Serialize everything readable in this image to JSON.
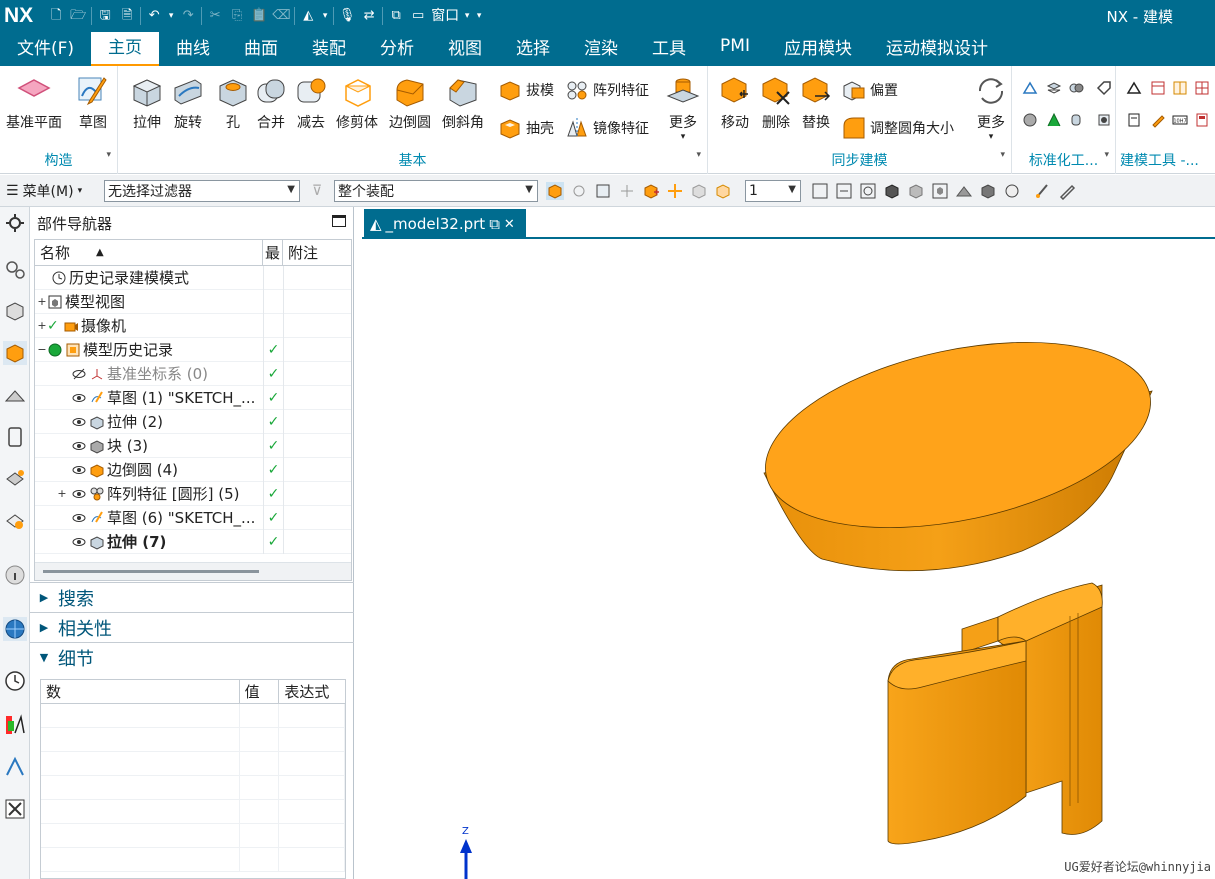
{
  "app": {
    "logo": "NX",
    "title": "NX - 建模",
    "window_menu": "窗口"
  },
  "menu_tabs": [
    "文件(F)",
    "主页",
    "曲线",
    "曲面",
    "装配",
    "分析",
    "视图",
    "选择",
    "渲染",
    "工具",
    "PMI",
    "应用模块",
    "运动模拟设计"
  ],
  "active_tab": "主页",
  "ribbon": {
    "construct": {
      "label": "构造",
      "buttons": [
        "基准平面",
        "草图"
      ]
    },
    "basic": {
      "label": "基本",
      "buttons": [
        "拉伸",
        "旋转",
        "孔",
        "合并",
        "减去",
        "修剪体",
        "边倒圆",
        "倒斜角"
      ],
      "small": [
        "拔模",
        "阵列特征",
        "抽壳",
        "镜像特征"
      ],
      "more": "更多"
    },
    "sync": {
      "label": "同步建模",
      "buttons": [
        "移动",
        "删除",
        "替换"
      ],
      "small": [
        "偏置",
        "调整圆角大小"
      ],
      "more": "更多"
    },
    "standard": {
      "label": "标准化工..."
    },
    "buildtools": {
      "label": "建模工具 -..."
    }
  },
  "toolbar2": {
    "menu": "菜单(M)",
    "filter": "无选择过滤器",
    "scope": "整个装配",
    "count": "1"
  },
  "navigator": {
    "title": "部件导航器",
    "columns": [
      "名称",
      "最",
      "附注"
    ],
    "rows": [
      {
        "label": "历史记录建模模式",
        "check": false
      },
      {
        "label": "模型视图",
        "check": false
      },
      {
        "label": "摄像机",
        "check": false
      },
      {
        "label": "模型历史记录",
        "check": true
      },
      {
        "label": "基准坐标系 (0)",
        "check": true
      },
      {
        "label": "草图 (1) \"SKETCH_...",
        "check": true
      },
      {
        "label": "拉伸 (2)",
        "check": true
      },
      {
        "label": "块 (3)",
        "check": true
      },
      {
        "label": "边倒圆 (4)",
        "check": true
      },
      {
        "label": "阵列特征 [圆形] (5)",
        "check": true
      },
      {
        "label": "草图 (6) \"SKETCH_...",
        "check": true
      },
      {
        "label": "拉伸 (7)",
        "check": true
      }
    ],
    "check_mark": "✓"
  },
  "sections": {
    "search": "搜索",
    "dependency": "相关性",
    "details": "细节"
  },
  "details": {
    "columns": [
      "数",
      "值",
      "表达式"
    ]
  },
  "document_tab": {
    "name": "_model32.prt"
  },
  "axis_label": "Z",
  "watermark": "UG爱好者论坛@whinnyjia",
  "colors": {
    "brand": "#006c8f",
    "part": "#ff9e0f",
    "check": "#1aa83a"
  }
}
